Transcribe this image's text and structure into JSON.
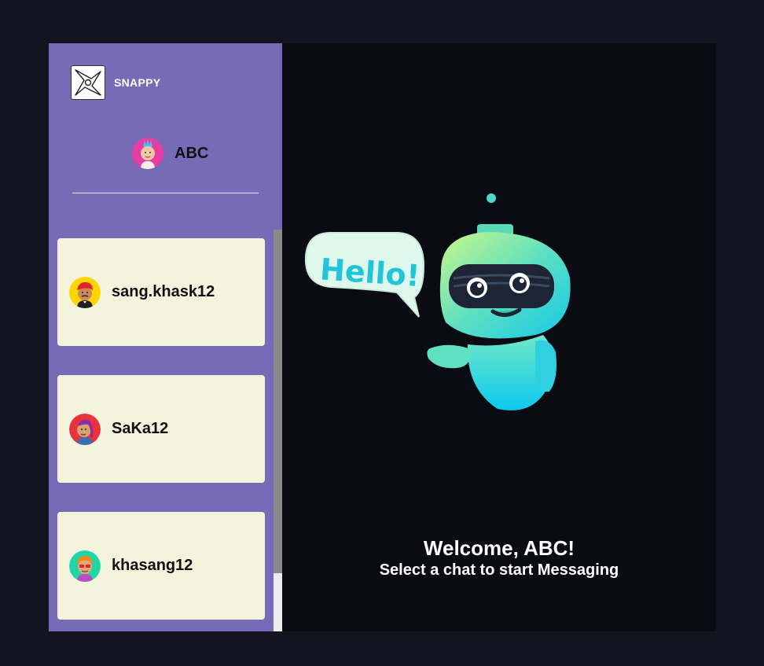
{
  "brand": {
    "name": "SNAPPY",
    "logo_icon": "shuriken-icon"
  },
  "current_user": {
    "username": "ABC",
    "avatar_icon": "avatar-mohawk-icon",
    "avatar_bg": "#e63ca3"
  },
  "contacts": [
    {
      "username": "sang.khask12",
      "avatar_icon": "avatar-red-hair-icon",
      "avatar_bg": "#ffd400"
    },
    {
      "username": "SaKa12",
      "avatar_icon": "avatar-purple-hair-icon",
      "avatar_bg": "#e8323c"
    },
    {
      "username": "khasang12",
      "avatar_icon": "avatar-orange-hair-icon",
      "avatar_bg": "#1fd6a6"
    }
  ],
  "welcome": {
    "greeting": "Welcome, ABC!",
    "subtitle": "Select a chat to start Messaging",
    "illustration_text": "Hello!",
    "illustration_icon": "robot-hello-icon"
  },
  "colors": {
    "sidebar": "#776bb8",
    "main": "#0b0c13",
    "card": "#f4f3dc",
    "page": "#141421"
  }
}
